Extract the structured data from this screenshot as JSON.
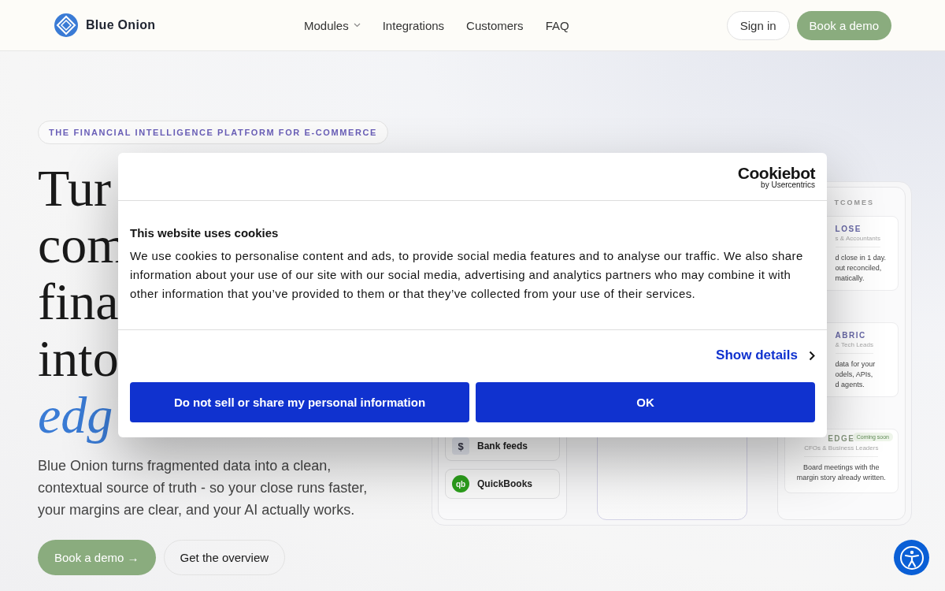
{
  "nav": {
    "brand": "Blue Onion",
    "links": [
      {
        "label": "Modules",
        "dropdown": true
      },
      {
        "label": "Integrations",
        "dropdown": false
      },
      {
        "label": "Customers",
        "dropdown": false
      },
      {
        "label": "FAQ",
        "dropdown": false
      }
    ],
    "sign_in": "Sign in",
    "cta": "Book a demo"
  },
  "hero": {
    "eyebrow": "THE FINANCIAL INTELLIGENCE PLATFORM FOR E-COMMERCE",
    "headline": [
      "Tur",
      "com",
      "fina",
      "into"
    ],
    "headline_accent": "edg",
    "lead": "Blue Onion turns fragmented data into a clean, contextual source of truth - so your close runs faster, your margins are clear, and your AI actually works.",
    "primary": "Book a demo →",
    "secondary": "Get the overview"
  },
  "diagram": {
    "sources": [
      {
        "label": "Bank feeds",
        "icon": "$"
      },
      {
        "label": "QuickBooks",
        "icon": "qb"
      }
    ],
    "outcomes_heading": "TCOMES",
    "outcomes": [
      {
        "title": "LOSE",
        "audience": "s & Accountants",
        "body": [
          "d close in 1 day.",
          "out reconciled,",
          "matically."
        ]
      },
      {
        "title": "ABRIC",
        "audience": "& Tech Leads",
        "body": [
          "data for your",
          "odels, APIs,",
          "d agents."
        ]
      },
      {
        "title": "EDGE",
        "audience": "CFOs & Business Leaders",
        "badge": "Coming soon",
        "body": [
          "Board meetings with the",
          "margin story already written."
        ]
      }
    ]
  },
  "cookie_dialog": {
    "logo": "Cookiebot",
    "logo_sub": "by Usercentrics",
    "title": "This website uses cookies",
    "text": "We use cookies to personalise content and ads, to provide social media features and to analyse our traffic. We also share information about your use of our site with our social media, advertising and analytics partners who may combine it with other information that you’ve provided to them or that they’ve collected from your use of their services.",
    "details": "Show details",
    "buttons": [
      "Do not sell or share my personal information",
      "OK"
    ]
  }
}
